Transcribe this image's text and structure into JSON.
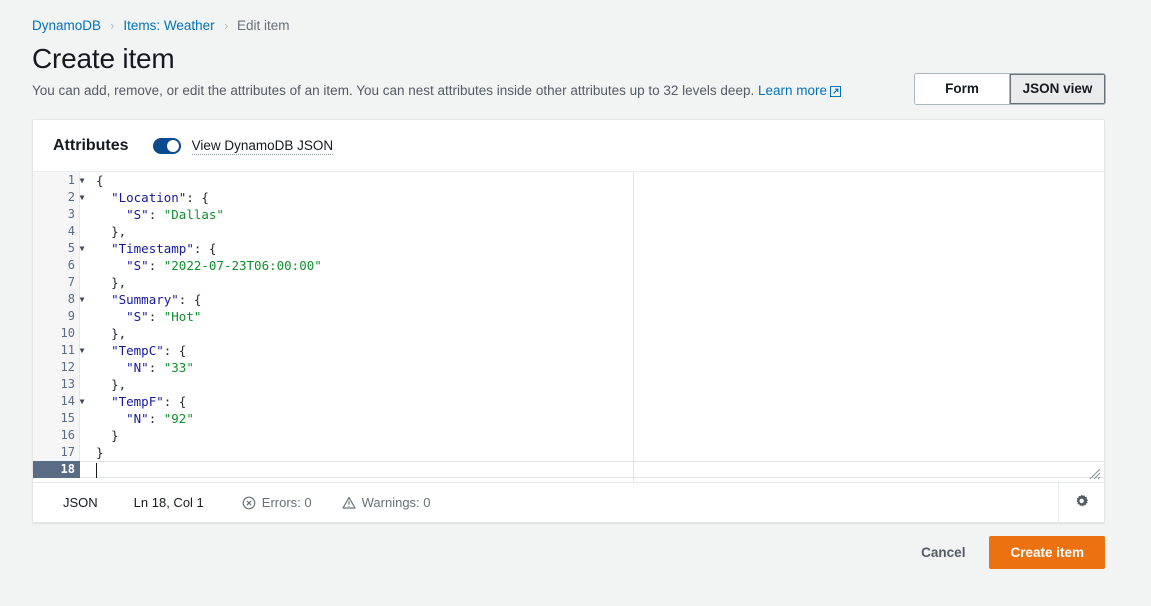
{
  "breadcrumb": {
    "items": [
      {
        "label": "DynamoDB",
        "current": false
      },
      {
        "label": "Items: Weather",
        "current": false
      },
      {
        "label": "Edit item",
        "current": true
      }
    ],
    "separator": "›"
  },
  "header": {
    "title": "Create item",
    "description": "You can add, remove, or edit the attributes of an item. You can nest attributes inside other attributes up to 32 levels deep.",
    "learn_more_label": "Learn more",
    "external_link_icon": "external-link-icon"
  },
  "view_switcher": {
    "options": [
      {
        "label": "Form",
        "selected": false
      },
      {
        "label": "JSON view",
        "selected": true
      }
    ]
  },
  "attributes_panel": {
    "title": "Attributes",
    "toggle": {
      "label": "View DynamoDB JSON",
      "checked": true
    }
  },
  "editor": {
    "language": "JSON",
    "total_lines": 18,
    "active_line": 18,
    "lines": [
      {
        "number": 1,
        "foldable": true,
        "indent": 0,
        "tokens": [
          {
            "t": "punc",
            "v": "{"
          }
        ]
      },
      {
        "number": 2,
        "foldable": true,
        "indent": 1,
        "tokens": [
          {
            "t": "key",
            "v": "\"Location\""
          },
          {
            "t": "punc",
            "v": ": {"
          }
        ]
      },
      {
        "number": 3,
        "foldable": false,
        "indent": 2,
        "tokens": [
          {
            "t": "key",
            "v": "\"S\""
          },
          {
            "t": "punc",
            "v": ": "
          },
          {
            "t": "str",
            "v": "\"Dallas\""
          }
        ]
      },
      {
        "number": 4,
        "foldable": false,
        "indent": 1,
        "tokens": [
          {
            "t": "punc",
            "v": "},"
          }
        ]
      },
      {
        "number": 5,
        "foldable": true,
        "indent": 1,
        "tokens": [
          {
            "t": "key",
            "v": "\"Timestamp\""
          },
          {
            "t": "punc",
            "v": ": {"
          }
        ]
      },
      {
        "number": 6,
        "foldable": false,
        "indent": 2,
        "tokens": [
          {
            "t": "key",
            "v": "\"S\""
          },
          {
            "t": "punc",
            "v": ": "
          },
          {
            "t": "str",
            "v": "\"2022-07-23T06:00:00\""
          }
        ]
      },
      {
        "number": 7,
        "foldable": false,
        "indent": 1,
        "tokens": [
          {
            "t": "punc",
            "v": "},"
          }
        ]
      },
      {
        "number": 8,
        "foldable": true,
        "indent": 1,
        "tokens": [
          {
            "t": "key",
            "v": "\"Summary\""
          },
          {
            "t": "punc",
            "v": ": {"
          }
        ]
      },
      {
        "number": 9,
        "foldable": false,
        "indent": 2,
        "tokens": [
          {
            "t": "key",
            "v": "\"S\""
          },
          {
            "t": "punc",
            "v": ": "
          },
          {
            "t": "str",
            "v": "\"Hot\""
          }
        ]
      },
      {
        "number": 10,
        "foldable": false,
        "indent": 1,
        "tokens": [
          {
            "t": "punc",
            "v": "},"
          }
        ]
      },
      {
        "number": 11,
        "foldable": true,
        "indent": 1,
        "tokens": [
          {
            "t": "key",
            "v": "\"TempC\""
          },
          {
            "t": "punc",
            "v": ": {"
          }
        ]
      },
      {
        "number": 12,
        "foldable": false,
        "indent": 2,
        "tokens": [
          {
            "t": "key",
            "v": "\"N\""
          },
          {
            "t": "punc",
            "v": ": "
          },
          {
            "t": "str",
            "v": "\"33\""
          }
        ]
      },
      {
        "number": 13,
        "foldable": false,
        "indent": 1,
        "tokens": [
          {
            "t": "punc",
            "v": "},"
          }
        ]
      },
      {
        "number": 14,
        "foldable": true,
        "indent": 1,
        "tokens": [
          {
            "t": "key",
            "v": "\"TempF\""
          },
          {
            "t": "punc",
            "v": ": {"
          }
        ]
      },
      {
        "number": 15,
        "foldable": false,
        "indent": 2,
        "tokens": [
          {
            "t": "key",
            "v": "\"N\""
          },
          {
            "t": "punc",
            "v": ": "
          },
          {
            "t": "str",
            "v": "\"92\""
          }
        ]
      },
      {
        "number": 16,
        "foldable": false,
        "indent": 1,
        "tokens": [
          {
            "t": "punc",
            "v": "}"
          }
        ]
      },
      {
        "number": 17,
        "foldable": false,
        "indent": 0,
        "tokens": [
          {
            "t": "punc",
            "v": "}"
          }
        ]
      },
      {
        "number": 18,
        "foldable": false,
        "indent": 0,
        "tokens": []
      }
    ],
    "fold_glyph": "▼"
  },
  "statusbar": {
    "language": "JSON",
    "cursor": "Ln 18, Col 1",
    "errors_label": "Errors: 0",
    "warnings_label": "Warnings: 0",
    "errors_icon": "error-circle-icon",
    "warnings_icon": "warning-triangle-icon",
    "settings_icon": "gear-icon"
  },
  "footer": {
    "cancel_label": "Cancel",
    "create_label": "Create item"
  },
  "colors": {
    "page_background": "#f2f3f3",
    "primary_button": "#ec7211",
    "link": "#0073bb",
    "toggle_on": "#0a4a8f",
    "json_key": "#17189e",
    "json_string": "#108f2e",
    "active_line_gutter": "#5a6b84"
  }
}
